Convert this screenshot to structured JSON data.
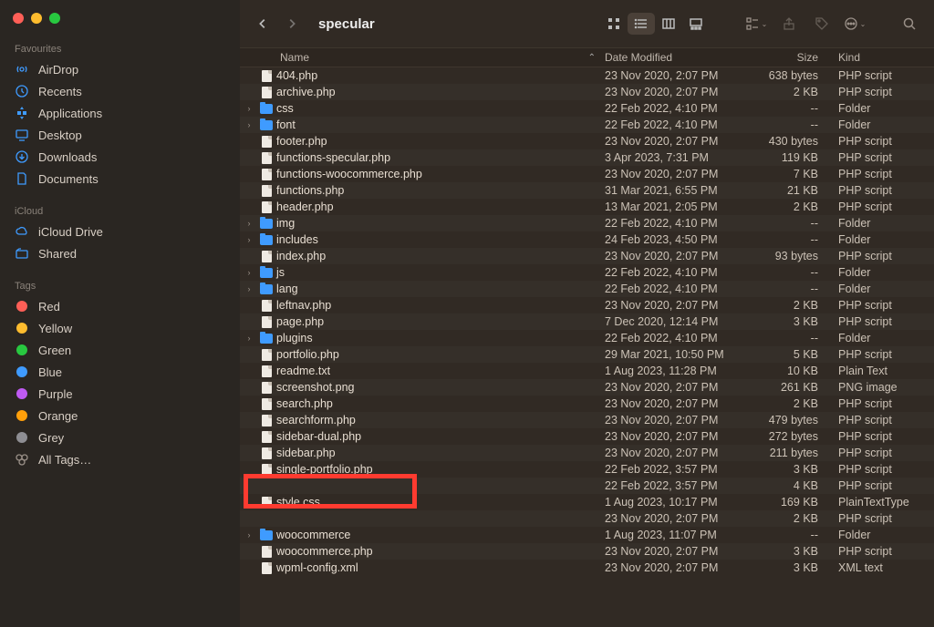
{
  "toolbar": {
    "folder_title": "specular"
  },
  "sidebar": {
    "sections": [
      {
        "title": "Favourites",
        "items": [
          {
            "label": "AirDrop",
            "icon": "airdrop"
          },
          {
            "label": "Recents",
            "icon": "clock"
          },
          {
            "label": "Applications",
            "icon": "apps"
          },
          {
            "label": "Desktop",
            "icon": "desktop"
          },
          {
            "label": "Downloads",
            "icon": "download"
          },
          {
            "label": "Documents",
            "icon": "doc"
          }
        ]
      },
      {
        "title": "iCloud",
        "items": [
          {
            "label": "iCloud Drive",
            "icon": "cloud"
          },
          {
            "label": "Shared",
            "icon": "shared"
          }
        ]
      },
      {
        "title": "Tags",
        "items": [
          {
            "label": "Red",
            "tag": "red"
          },
          {
            "label": "Yellow",
            "tag": "yellow"
          },
          {
            "label": "Green",
            "tag": "green"
          },
          {
            "label": "Blue",
            "tag": "blue"
          },
          {
            "label": "Purple",
            "tag": "purple"
          },
          {
            "label": "Orange",
            "tag": "orange"
          },
          {
            "label": "Grey",
            "tag": "grey"
          },
          {
            "label": "All Tags…",
            "icon": "alltags"
          }
        ]
      }
    ]
  },
  "columns": {
    "name": "Name",
    "date": "Date Modified",
    "size": "Size",
    "kind": "Kind",
    "sort_indicator": "⌃"
  },
  "files": [
    {
      "name": "404.php",
      "date": "23 Nov 2020, 2:07 PM",
      "size": "638 bytes",
      "kind": "PHP script",
      "type": "file"
    },
    {
      "name": "archive.php",
      "date": "23 Nov 2020, 2:07 PM",
      "size": "2 KB",
      "kind": "PHP script",
      "type": "file"
    },
    {
      "name": "css",
      "date": "22 Feb 2022, 4:10 PM",
      "size": "--",
      "kind": "Folder",
      "type": "folder",
      "disclosure": true
    },
    {
      "name": "font",
      "date": "22 Feb 2022, 4:10 PM",
      "size": "--",
      "kind": "Folder",
      "type": "folder",
      "disclosure": true
    },
    {
      "name": "footer.php",
      "date": "23 Nov 2020, 2:07 PM",
      "size": "430 bytes",
      "kind": "PHP script",
      "type": "file"
    },
    {
      "name": "functions-specular.php",
      "date": "3 Apr 2023, 7:31 PM",
      "size": "119 KB",
      "kind": "PHP script",
      "type": "file"
    },
    {
      "name": "functions-woocommerce.php",
      "date": "23 Nov 2020, 2:07 PM",
      "size": "7 KB",
      "kind": "PHP script",
      "type": "file"
    },
    {
      "name": "functions.php",
      "date": "31 Mar 2021, 6:55 PM",
      "size": "21 KB",
      "kind": "PHP script",
      "type": "file"
    },
    {
      "name": "header.php",
      "date": "13 Mar 2021, 2:05 PM",
      "size": "2 KB",
      "kind": "PHP script",
      "type": "file"
    },
    {
      "name": "img",
      "date": "22 Feb 2022, 4:10 PM",
      "size": "--",
      "kind": "Folder",
      "type": "folder",
      "disclosure": true
    },
    {
      "name": "includes",
      "date": "24 Feb 2023, 4:50 PM",
      "size": "--",
      "kind": "Folder",
      "type": "folder",
      "disclosure": true
    },
    {
      "name": "index.php",
      "date": "23 Nov 2020, 2:07 PM",
      "size": "93 bytes",
      "kind": "PHP script",
      "type": "file"
    },
    {
      "name": "js",
      "date": "22 Feb 2022, 4:10 PM",
      "size": "--",
      "kind": "Folder",
      "type": "folder",
      "disclosure": true
    },
    {
      "name": "lang",
      "date": "22 Feb 2022, 4:10 PM",
      "size": "--",
      "kind": "Folder",
      "type": "folder",
      "disclosure": true
    },
    {
      "name": "leftnav.php",
      "date": "23 Nov 2020, 2:07 PM",
      "size": "2 KB",
      "kind": "PHP script",
      "type": "file"
    },
    {
      "name": "page.php",
      "date": "7 Dec 2020, 12:14 PM",
      "size": "3 KB",
      "kind": "PHP script",
      "type": "file"
    },
    {
      "name": "plugins",
      "date": "22 Feb 2022, 4:10 PM",
      "size": "--",
      "kind": "Folder",
      "type": "folder",
      "disclosure": true
    },
    {
      "name": "portfolio.php",
      "date": "29 Mar 2021, 10:50 PM",
      "size": "5 KB",
      "kind": "PHP script",
      "type": "file"
    },
    {
      "name": "readme.txt",
      "date": "1 Aug 2023, 11:28 PM",
      "size": "10 KB",
      "kind": "Plain Text",
      "type": "file"
    },
    {
      "name": "screenshot.png",
      "date": "23 Nov 2020, 2:07 PM",
      "size": "261 KB",
      "kind": "PNG image",
      "type": "file"
    },
    {
      "name": "search.php",
      "date": "23 Nov 2020, 2:07 PM",
      "size": "2 KB",
      "kind": "PHP script",
      "type": "file"
    },
    {
      "name": "searchform.php",
      "date": "23 Nov 2020, 2:07 PM",
      "size": "479 bytes",
      "kind": "PHP script",
      "type": "file"
    },
    {
      "name": "sidebar-dual.php",
      "date": "23 Nov 2020, 2:07 PM",
      "size": "272 bytes",
      "kind": "PHP script",
      "type": "file"
    },
    {
      "name": "sidebar.php",
      "date": "23 Nov 2020, 2:07 PM",
      "size": "211 bytes",
      "kind": "PHP script",
      "type": "file"
    },
    {
      "name": "single-portfolio.php",
      "date": "22 Feb 2022, 3:57 PM",
      "size": "3 KB",
      "kind": "PHP script",
      "type": "file"
    },
    {
      "name": "",
      "date": "22 Feb 2022, 3:57 PM",
      "size": "4 KB",
      "kind": "PHP script",
      "type": "file",
      "hidden": true
    },
    {
      "name": "style.css",
      "date": "1 Aug 2023, 10:17 PM",
      "size": "169 KB",
      "kind": "PlainTextType",
      "type": "file"
    },
    {
      "name": "",
      "date": "23 Nov 2020, 2:07 PM",
      "size": "2 KB",
      "kind": "PHP script",
      "type": "file",
      "hidden": true
    },
    {
      "name": "woocommerce",
      "date": "1 Aug 2023, 11:07 PM",
      "size": "--",
      "kind": "Folder",
      "type": "folder",
      "disclosure": true
    },
    {
      "name": "woocommerce.php",
      "date": "23 Nov 2020, 2:07 PM",
      "size": "3 KB",
      "kind": "PHP script",
      "type": "file"
    },
    {
      "name": "wpml-config.xml",
      "date": "23 Nov 2020, 2:07 PM",
      "size": "3 KB",
      "kind": "XML text",
      "type": "file"
    }
  ],
  "highlight_index": 26
}
